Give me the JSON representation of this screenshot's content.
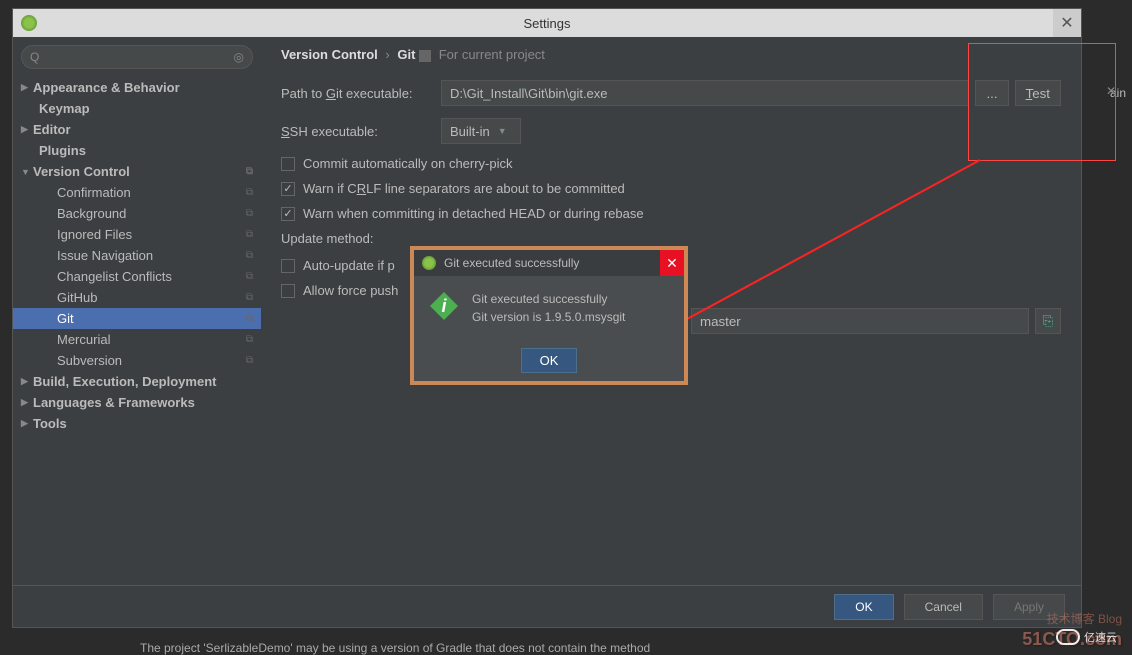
{
  "window": {
    "title": "Settings"
  },
  "sidebar": {
    "items": [
      {
        "label": "Appearance & Behavior",
        "bold": true,
        "arrow": "▶",
        "indent": 0
      },
      {
        "label": "Keymap",
        "bold": true,
        "indent": 1
      },
      {
        "label": "Editor",
        "bold": true,
        "arrow": "▶",
        "indent": 0
      },
      {
        "label": "Plugins",
        "bold": true,
        "indent": 1
      },
      {
        "label": "Version Control",
        "bold": true,
        "arrow": "▼",
        "indent": 0,
        "copy": true
      },
      {
        "label": "Confirmation",
        "indent": 2,
        "copy": true
      },
      {
        "label": "Background",
        "indent": 2,
        "copy": true
      },
      {
        "label": "Ignored Files",
        "indent": 2,
        "copy": true
      },
      {
        "label": "Issue Navigation",
        "indent": 2,
        "copy": true
      },
      {
        "label": "Changelist Conflicts",
        "indent": 2,
        "copy": true
      },
      {
        "label": "GitHub",
        "indent": 2,
        "copy": true
      },
      {
        "label": "Git",
        "indent": 2,
        "copy": true,
        "selected": true
      },
      {
        "label": "Mercurial",
        "indent": 2,
        "copy": true
      },
      {
        "label": "Subversion",
        "indent": 2,
        "copy": true
      },
      {
        "label": "Build, Execution, Deployment",
        "bold": true,
        "arrow": "▶",
        "indent": 0
      },
      {
        "label": "Languages & Frameworks",
        "bold": true,
        "arrow": "▶",
        "indent": 0
      },
      {
        "label": "Tools",
        "bold": true,
        "arrow": "▶",
        "indent": 0
      }
    ]
  },
  "breadcrumb": {
    "crumb1": "Version Control",
    "crumb2": "Git",
    "project": "For current project"
  },
  "form": {
    "path_label": "Path to Git executable:",
    "path_value": "D:\\Git_Install\\Git\\bin\\git.exe",
    "browse": "...",
    "test": "Test",
    "ssh_label": "SSH executable:",
    "ssh_value": "Built-in",
    "check_cherry": "Commit automatically on cherry-pick",
    "check_crlf": "Warn if CRLF line separators are about to be committed",
    "check_detached": "Warn when committing in detached HEAD or during rebase",
    "update_label": "Update method:",
    "check_autoupdate": "Auto-update if p",
    "check_forcepush": "Allow force push",
    "branch_value": "master"
  },
  "dialog": {
    "title": "Git executed successfully",
    "line1": "Git executed successfully",
    "line2": "Git version is 1.9.5.0.msysgit",
    "ok": "OK"
  },
  "footer": {
    "ok": "OK",
    "cancel": "Cancel",
    "apply": "Apply"
  },
  "watermark": {
    "w1": "51CTO.com",
    "w2": "技术博客  Blog",
    "w3": "亿速云"
  },
  "background": {
    "tab": "ain",
    "status": "The project 'SerlizableDemo' may be using a version of Gradle that does not contain the method"
  }
}
